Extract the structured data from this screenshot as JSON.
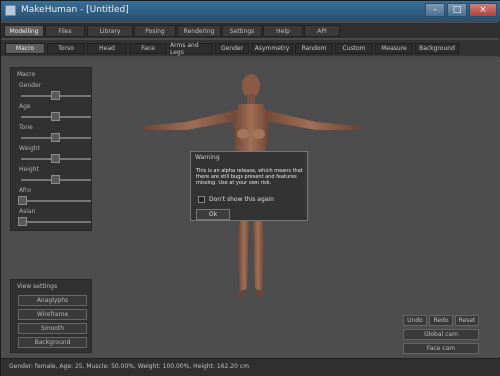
{
  "window": {
    "title": "MakeHuman - [Untitled]",
    "minimize": "-",
    "maximize": "□",
    "close": "×"
  },
  "top_tabs": [
    "Modelling",
    "Files",
    "Library",
    "Posing",
    "Rendering",
    "Settings",
    "Help",
    "API"
  ],
  "sub_tabs": [
    "Macro",
    "Torso",
    "Head",
    "Face",
    "Arms and Legs",
    "Gender",
    "Asymmetry",
    "Random",
    "Custom",
    "Measure",
    "Background"
  ],
  "macro_panel": {
    "title": "Macro",
    "sliders": [
      {
        "label": "Gender",
        "value": 0.5
      },
      {
        "label": "Age",
        "value": 0.5
      },
      {
        "label": "Tone",
        "value": 0.5
      },
      {
        "label": "Weight",
        "value": 0.5
      },
      {
        "label": "Height",
        "value": 0.5
      },
      {
        "label": "Afro",
        "value": 0.0
      },
      {
        "label": "Asian",
        "value": 0.0
      }
    ]
  },
  "view_panel": {
    "title": "View settings",
    "buttons": [
      "Anaglyphs",
      "Wireframe",
      "Smooth",
      "Background"
    ]
  },
  "dialog": {
    "title": "Warning",
    "message": "This is an alpha release, which means that there are still bugs present and features missing. Use at your own risk.",
    "checkbox_label": "Don't show this again",
    "ok_label": "Ok"
  },
  "corner_buttons": {
    "undo": "Undo",
    "redo": "Redo",
    "reset": "Reset",
    "globalcam": "Global cam",
    "facecam": "Face cam"
  },
  "status": "Gender: female, Age: 25, Muscle: 50.00%, Weight: 100.00%, Height: 162.20 cm",
  "colors": {
    "viewport_bg": "#4d4d4d",
    "panel_bg": "#313131",
    "skin": "#9b6b53"
  }
}
